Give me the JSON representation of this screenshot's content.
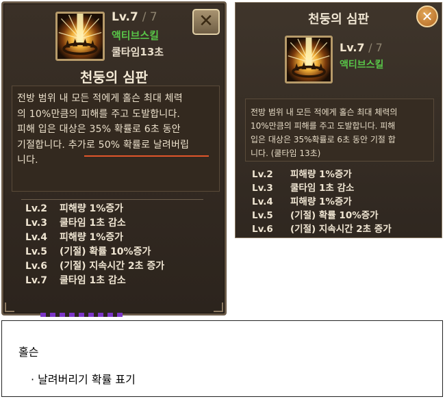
{
  "left_panel": {
    "level": "Lv.7",
    "level_max": "/ 7",
    "skill_type": "액티브스킬",
    "cooldown": "쿨타임13초",
    "title": "천둥의 심판",
    "close_symbol": "✕",
    "description_lines": [
      "전방 범위 내 모든 적에게 홀슨 최대 체력",
      "의 10%만큼의 피해를 주고 도발합니다.",
      "피해 입은 대상은 35% 확률로 6초 동안",
      "기절합니다. 추가로 50% 확률로 날려버립",
      "니다."
    ],
    "highlight_color": "#e2562a",
    "levels": [
      {
        "lv": "Lv.2",
        "text": "피해량 1%증가"
      },
      {
        "lv": "Lv.3",
        "text": "쿨타임 1초 감소"
      },
      {
        "lv": "Lv.4",
        "text": "피해량 1%증가"
      },
      {
        "lv": "Lv.5",
        "text": "(기절) 확률 10%증가"
      },
      {
        "lv": "Lv.6",
        "text": "(기절) 지속시간 2초 증가"
      },
      {
        "lv": "Lv.7",
        "text": "쿨타임 1초 감소"
      }
    ]
  },
  "right_panel": {
    "title": "천둥의 심판",
    "close_symbol": "✕",
    "level": "Lv.7",
    "level_max": "/ 7",
    "skill_type": "액티브스킬",
    "description_lines": [
      "전방 범위 내 모든 적에게 홀슨 최대 체력의",
      "10%만큼의 피해를 주고 도발합니다. 피해",
      "입은 대상은 35%확률로 6초 동안 기절 합",
      "니다. (쿨타임 13초)"
    ],
    "levels": [
      {
        "lv": "Lv.2",
        "text": "피해량 1%증가"
      },
      {
        "lv": "Lv.3",
        "text": "쿨타임 1초 감소"
      },
      {
        "lv": "Lv.4",
        "text": "피해량 1%증가"
      },
      {
        "lv": "Lv.5",
        "text": "(기절) 확률 10%증가"
      },
      {
        "lv": "Lv.6",
        "text": "(기절) 지속시간 2초 증가"
      }
    ]
  },
  "note": {
    "heading": "홀슨",
    "bullet": "· 날려버리기 확률 표기"
  },
  "colors": {
    "panel_bg": "#2c241d",
    "skill_type_green": "#58c448",
    "text_light": "#efe5d2"
  },
  "icons": {
    "skill": "thunder-crown-icon",
    "close": "close-icon"
  }
}
